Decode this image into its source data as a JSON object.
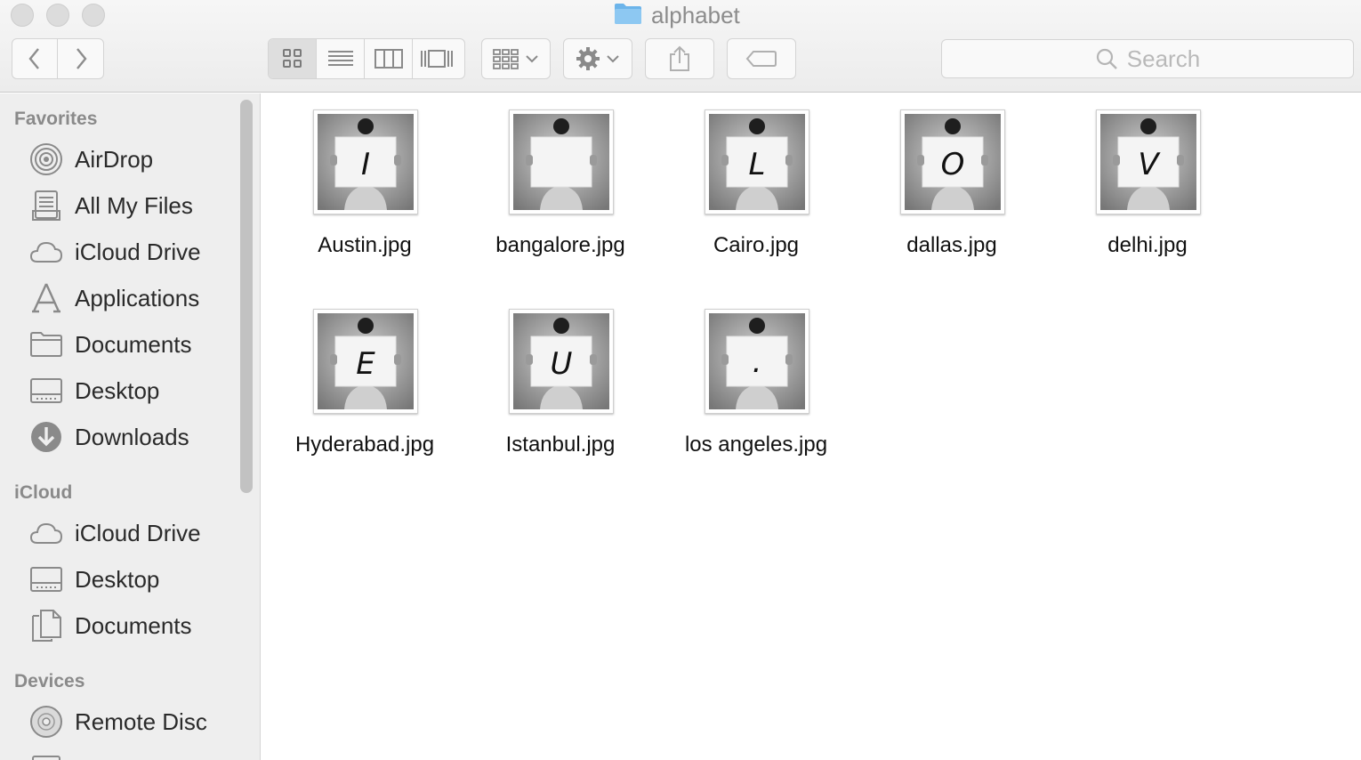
{
  "window": {
    "title": "alphabet"
  },
  "toolbar": {
    "search_placeholder": "Search"
  },
  "sidebar": {
    "sections": [
      {
        "title": "Favorites",
        "items": [
          {
            "label": "AirDrop",
            "icon": "airdrop-icon"
          },
          {
            "label": "All My Files",
            "icon": "all-my-files-icon"
          },
          {
            "label": "iCloud Drive",
            "icon": "cloud-icon"
          },
          {
            "label": "Applications",
            "icon": "applications-icon"
          },
          {
            "label": "Documents",
            "icon": "folder-icon"
          },
          {
            "label": "Desktop",
            "icon": "desktop-icon"
          },
          {
            "label": "Downloads",
            "icon": "downloads-icon"
          }
        ]
      },
      {
        "title": "iCloud",
        "items": [
          {
            "label": "iCloud Drive",
            "icon": "cloud-icon"
          },
          {
            "label": "Desktop",
            "icon": "desktop-icon"
          },
          {
            "label": "Documents",
            "icon": "document-icon"
          }
        ]
      },
      {
        "title": "Devices",
        "items": [
          {
            "label": "Remote Disc",
            "icon": "disc-icon"
          }
        ]
      }
    ]
  },
  "files": [
    {
      "name": "Austin.jpg",
      "letter": "I"
    },
    {
      "name": "bangalore.jpg",
      "letter": ""
    },
    {
      "name": "Cairo.jpg",
      "letter": "L"
    },
    {
      "name": "dallas.jpg",
      "letter": "O"
    },
    {
      "name": "delhi.jpg",
      "letter": "V"
    },
    {
      "name": "Hyderabad.jpg",
      "letter": "E"
    },
    {
      "name": "Istanbul.jpg",
      "letter": "U"
    },
    {
      "name": "los angeles.jpg",
      "letter": "."
    }
  ],
  "colors": {
    "sidebar_bg": "#eeeeee",
    "toolbar_bg": "#ececec",
    "folder_blue": "#6cb4ea",
    "icon_gray": "#8a8a8a"
  }
}
